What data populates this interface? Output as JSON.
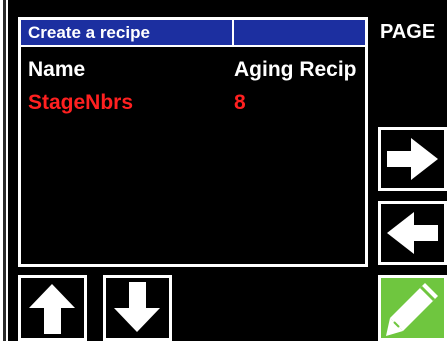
{
  "panel": {
    "title": "Create a recipe",
    "rows": [
      {
        "key": "Name",
        "value": "Aging Recip"
      },
      {
        "key": "StageNbrs",
        "value": "8"
      }
    ]
  },
  "page": {
    "label": "PAGE"
  },
  "buttons": {
    "next_icon": "arrow-right-icon",
    "prev_icon": "arrow-left-icon",
    "up_icon": "arrow-up-icon",
    "down_icon": "arrow-down-icon",
    "edit_icon": "pencil-icon"
  },
  "colors": {
    "header_bg": "#1c2fa0",
    "selected_row_text": "#ff2020",
    "edit_button_bg": "#6fc63f",
    "background": "#000000",
    "foreground": "#ffffff"
  }
}
